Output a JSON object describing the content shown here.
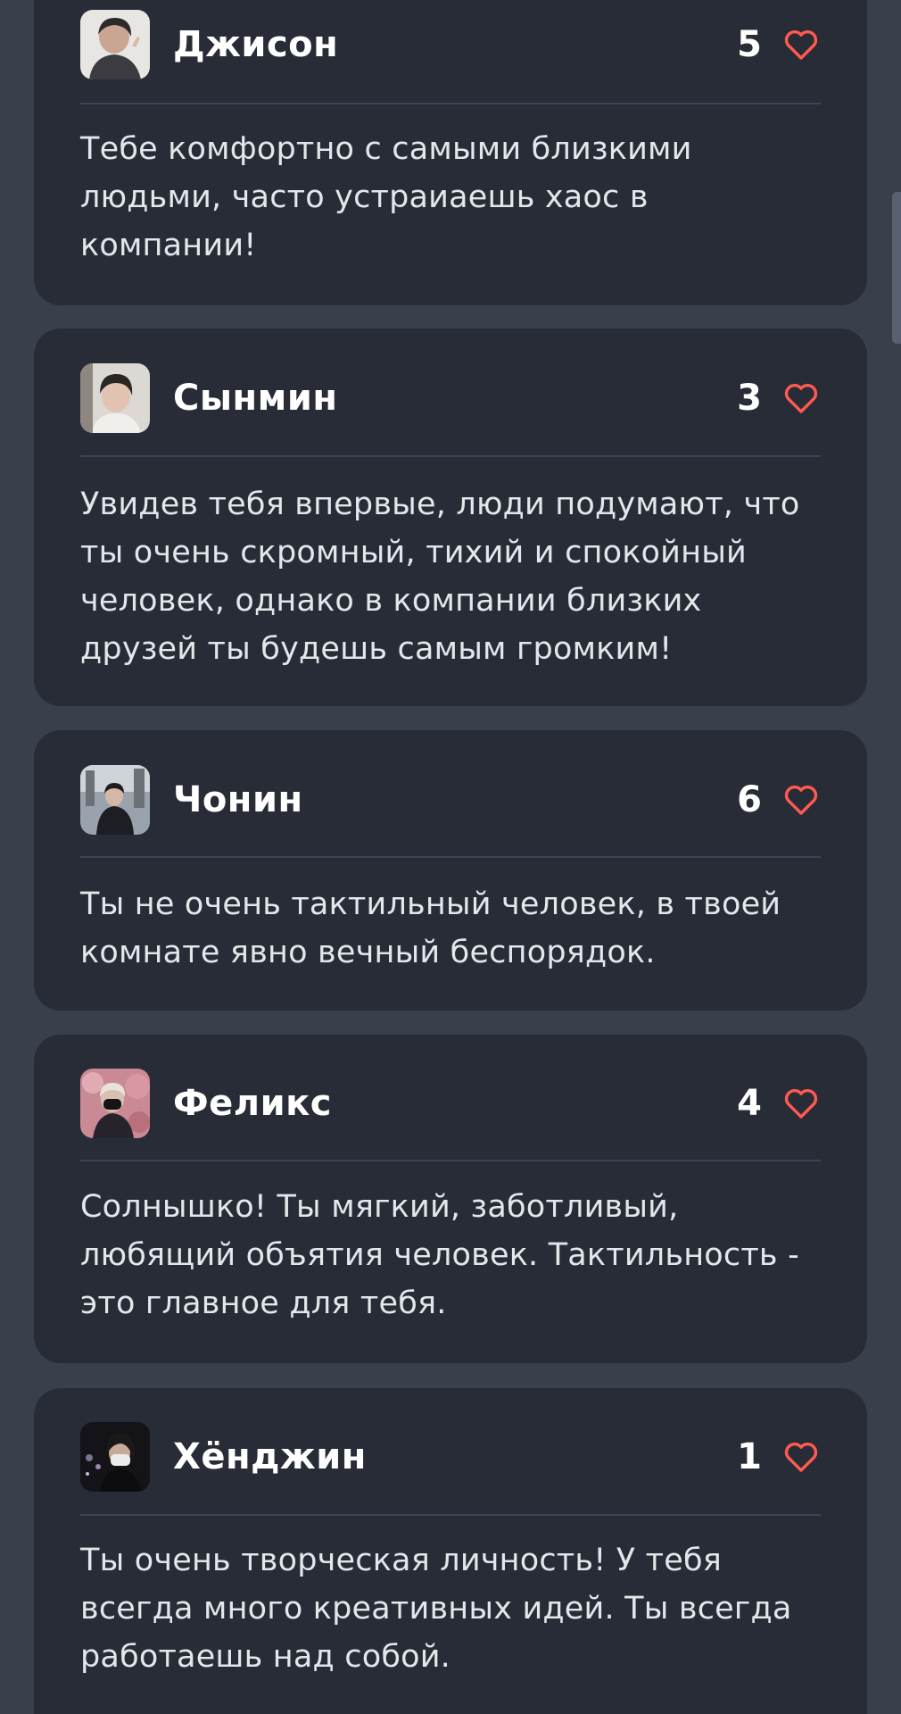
{
  "cards": [
    {
      "name": "Джисон",
      "count": "5",
      "text": "Тебе комфортно с самыми близкими людьми, часто устраиаешь хаос в компании!",
      "icon": "heart-outline-icon",
      "icon_color": "#ff5a52"
    },
    {
      "name": "Сынмин",
      "count": "3",
      "text": "Увидев тебя впервые, люди подумают, что ты очень скромный, тихий и спокойный человек, однако в компании близких друзей ты будешь самым громким!",
      "icon": "heart-outline-icon",
      "icon_color": "#ff5a52"
    },
    {
      "name": "Чонин",
      "count": "6",
      "text": "Ты не очень тактильный человек, в твоей комнате явно вечный беспорядок.",
      "icon": "heart-outline-icon",
      "icon_color": "#ff5a52"
    },
    {
      "name": "Феликс",
      "count": "4",
      "text": "Солнышко! Ты мягкий, заботливый, любящий объятия человек. Тактильность - это главное для тебя.",
      "icon": "heart-outline-icon",
      "icon_color": "#ff5a52"
    },
    {
      "name": "Хёнджин",
      "count": "1",
      "text": "Ты очень творческая личность! У тебя всегда много креативных идей. Ты всегда работаешь над собой.",
      "icon": "heart-outline-icon",
      "icon_color": "#ff5a52"
    }
  ],
  "colors": {
    "background": "#3a404b",
    "card": "#272c36",
    "accent": "#ff5a52",
    "text": "#e4e6ea"
  }
}
